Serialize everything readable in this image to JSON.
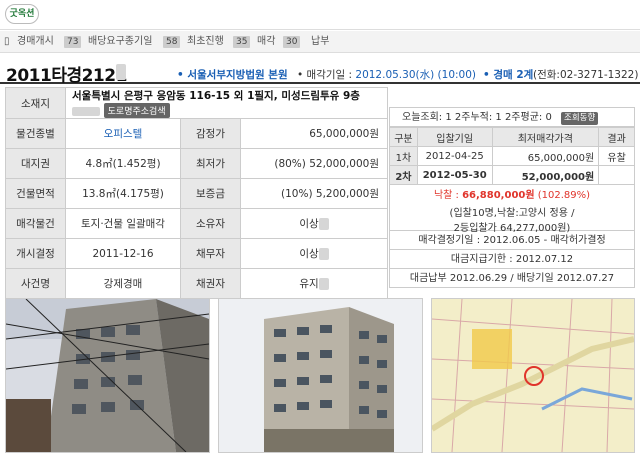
{
  "logo": "굿옥션",
  "steps": [
    {
      "label": "경매개시",
      "count": "73"
    },
    {
      "label": "배당요구종기일",
      "count": "58"
    },
    {
      "label": "최초진행",
      "count": "35"
    },
    {
      "label": "매각",
      "count": "30"
    },
    {
      "label": "납부",
      "count": ""
    }
  ],
  "header": {
    "case_no": "2011타경2121",
    "court": "• 서울서부지방법원 본원",
    "sale_label": "• 매각기일 : ",
    "sale_date": "2012.05.30(水) (10:00)",
    "dept": "• 경매 2계",
    "tel": "(전화:02-3271-1322)"
  },
  "property": {
    "address_label": "소재지",
    "address": "서울특별시 은평구 응암동 116-15 외 1필지, 미성드림투유 9층",
    "road_button": "도로명주소검색",
    "rows": [
      {
        "h1": "물건종별",
        "v1": "오피스텔",
        "h2": "감정가",
        "v2": "65,000,000원"
      },
      {
        "h1": "대지권",
        "v1": "4.8㎡(1.452평)",
        "h2": "최저가",
        "v2": "(80%) 52,000,000원"
      },
      {
        "h1": "건물면적",
        "v1": "13.8㎡(4.175평)",
        "h2": "보증금",
        "v2": "(10%) 5,200,000원"
      },
      {
        "h1": "매각물건",
        "v1": "토지·건물 일괄매각",
        "h2": "소유자",
        "v2": "이상"
      },
      {
        "h1": "개시결정",
        "v1": "2011-12-16",
        "h2": "채무자",
        "v2": "이상"
      },
      {
        "h1": "사건명",
        "v1": "강제경매",
        "h2": "채권자",
        "v2": "유지"
      }
    ]
  },
  "views": {
    "text": "오늘조회: 1 2주누적: 1 2주평균: 0",
    "button": "조회동향"
  },
  "bids": {
    "headers": [
      "구분",
      "입찰기일",
      "최저매각가격",
      "결과"
    ],
    "rows": [
      {
        "round": "1차",
        "date": "2012-04-25",
        "price": "65,000,000원",
        "result": "유찰"
      },
      {
        "round": "2차",
        "date": "2012-05-30",
        "price": "52,000,000원",
        "result": ""
      }
    ],
    "won_label": "낙찰 : ",
    "won_price": "66,880,000원",
    "won_rate": "(102.89%)",
    "bidders": "(입찰10명,낙찰:고양시 정용 /",
    "second": "2등입찰가 64,277,000원)",
    "approval": "매각결정기일 : 2012.06.05 - 매각허가결정",
    "deadline": "대금지급기한 : 2012.07.12",
    "payment": "대금납부 2012.06.29 / 배당기일 2012.07.27"
  }
}
